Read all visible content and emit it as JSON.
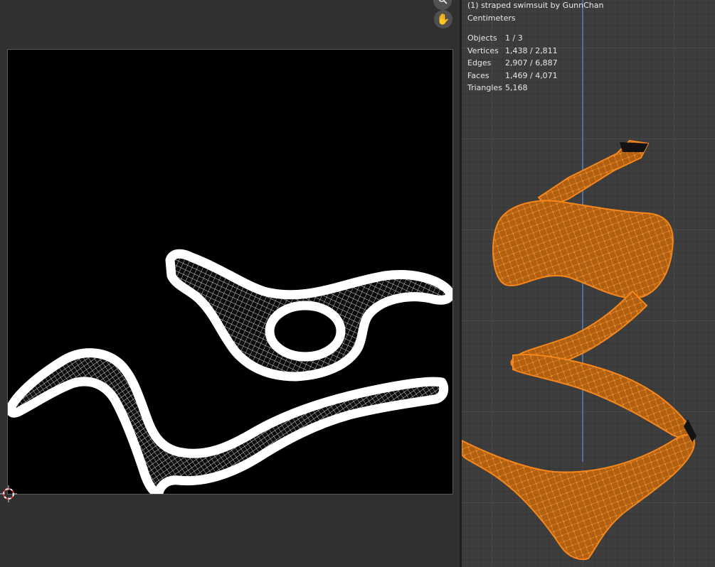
{
  "uv_editor": {
    "tools": {
      "zoom_icon": "magnifier-icon",
      "pan_icon": "hand-icon",
      "pan_glyph": "✋"
    }
  },
  "viewport": {
    "object_title": "(1) straped swimsuit by GunnChan",
    "units": "Centimeters",
    "stats": [
      {
        "label": "Objects",
        "value": "1 / 3"
      },
      {
        "label": "Vertices",
        "value": "1,438 / 2,811"
      },
      {
        "label": "Edges",
        "value": "2,907 / 6,887"
      },
      {
        "label": "Faces",
        "value": "1,469 / 4,071"
      },
      {
        "label": "Triangles",
        "value": "5,168"
      }
    ]
  },
  "colors": {
    "mesh_orange": "#f08a1e",
    "uv_island_outline": "#ffffff",
    "uv_background": "#000000",
    "z_axis": "#4d6fa5"
  }
}
